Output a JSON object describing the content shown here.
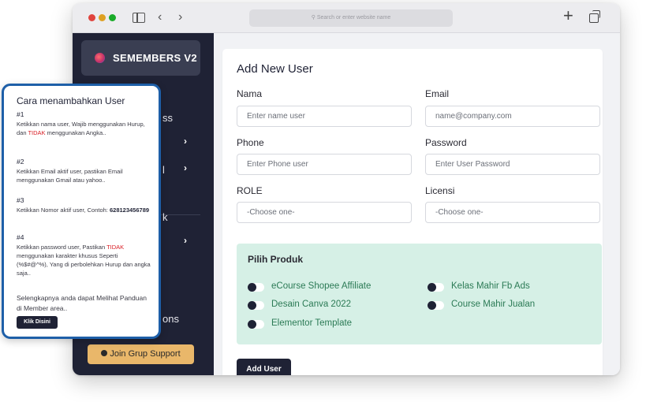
{
  "browser": {
    "url_placeholder": "Search or enter website name",
    "new_tab_glyph": "+",
    "back_glyph": "‹",
    "forward_glyph": "›"
  },
  "sidebar": {
    "brand": "SEMEMBERS V2",
    "fragments": [
      "ss",
      "l",
      "k",
      "ons"
    ],
    "chevron_glyph": "›",
    "support_button": "Join Grup Support"
  },
  "form": {
    "title": "Add New User",
    "fields": [
      {
        "label": "Nama",
        "placeholder": "Enter name user"
      },
      {
        "label": "Email",
        "placeholder": "name@company.com"
      },
      {
        "label": "Phone",
        "placeholder": "Enter Phone user"
      },
      {
        "label": "Password",
        "placeholder": "Enter User Password"
      },
      {
        "label": "ROLE",
        "placeholder": "-Choose one-"
      },
      {
        "label": "Licensi",
        "placeholder": "-Choose one-"
      }
    ],
    "produk": {
      "title": "Pilih Produk",
      "items": [
        "eCourse Shopee Affiliate",
        "Kelas Mahir Fb Ads",
        "Desain Canva 2022",
        "Course Mahir Jualan",
        "Elementor Template"
      ]
    },
    "submit": "Add User"
  },
  "guide": {
    "title": "Cara menambahkan User",
    "steps": [
      {
        "num": "#1",
        "a": "Ketikkan nama user, Wajib menggunakan Hurup, dan ",
        "red": "TIDAK",
        "b": " menggunakan Angka.."
      },
      {
        "num": "#2",
        "a": "Ketikkan Email aktif user, pastikan Email menggunakan Gmail atau yahoo.."
      },
      {
        "num": "#3",
        "a": "Ketikkan Nomor aktif user, Contoh: ",
        "bold": "628123456789"
      },
      {
        "num": "#4",
        "a": "Ketikkan password user, Pastikan ",
        "red": "TIDAK",
        "b": " menggunakan karakter khusus Seperti (%$#@^%), Yang di perbolehkan Hurup dan angka saja.."
      }
    ],
    "footer": "Selengkapnya anda dapat Melihat Panduan di Member area..",
    "button": "Klik Disini"
  },
  "colors": {
    "sidebar_bg": "#1f2235",
    "accent_blue": "#1e5fa8",
    "produk_bg": "#d6f0e6",
    "produk_text": "#2b7a55",
    "warning_red": "#d91f26",
    "support_btn": "#e9b76a"
  }
}
